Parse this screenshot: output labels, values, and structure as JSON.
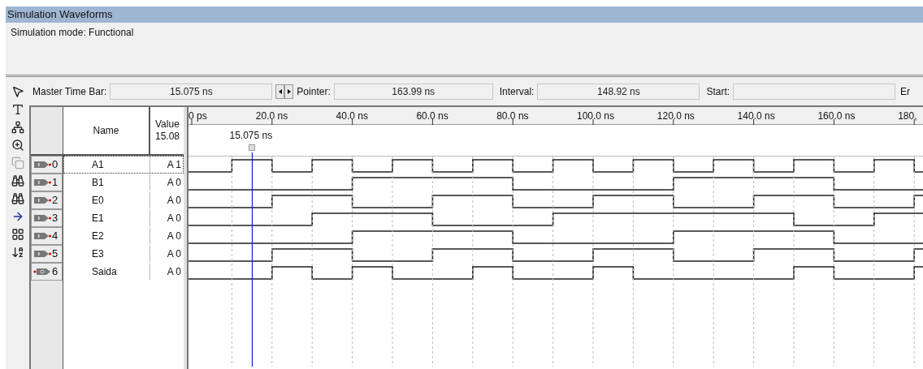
{
  "window": {
    "title": "Simulation Waveforms"
  },
  "mode_label": "Simulation mode: Functional",
  "time_bar": {
    "master_label": "Master Time Bar:",
    "master_value": "15.075 ns",
    "pointer_label": "Pointer:",
    "pointer_value": "163.99 ns",
    "interval_label": "Interval:",
    "interval_value": "148.92 ns",
    "start_label": "Start:",
    "end_label": "Er"
  },
  "table": {
    "name_header": "Name",
    "value_header": "Value",
    "value_time": "15.08"
  },
  "ruler": {
    "ticks": [
      "0 ps",
      "20.0 ns",
      "40.0 ns",
      "60.0 ns",
      "80.0 ns",
      "100.0 ns",
      "120.0 ns",
      "140.0 ns",
      "160.0 ns",
      "180,"
    ],
    "cursor_label": "15.075 ns"
  },
  "signals": [
    {
      "index": "0",
      "name": "A1",
      "value": "A 1",
      "kind": "input",
      "selected": true
    },
    {
      "index": "1",
      "name": "B1",
      "value": "A 0",
      "kind": "input",
      "selected": false
    },
    {
      "index": "2",
      "name": "E0",
      "value": "A 0",
      "kind": "input",
      "selected": false
    },
    {
      "index": "3",
      "name": "E1",
      "value": "A 0",
      "kind": "input",
      "selected": false
    },
    {
      "index": "4",
      "name": "E2",
      "value": "A 0",
      "kind": "input",
      "selected": false
    },
    {
      "index": "5",
      "name": "E3",
      "value": "A 0",
      "kind": "input",
      "selected": false
    },
    {
      "index": "6",
      "name": "Saida",
      "value": "A 0",
      "kind": "output",
      "selected": false
    }
  ]
}
